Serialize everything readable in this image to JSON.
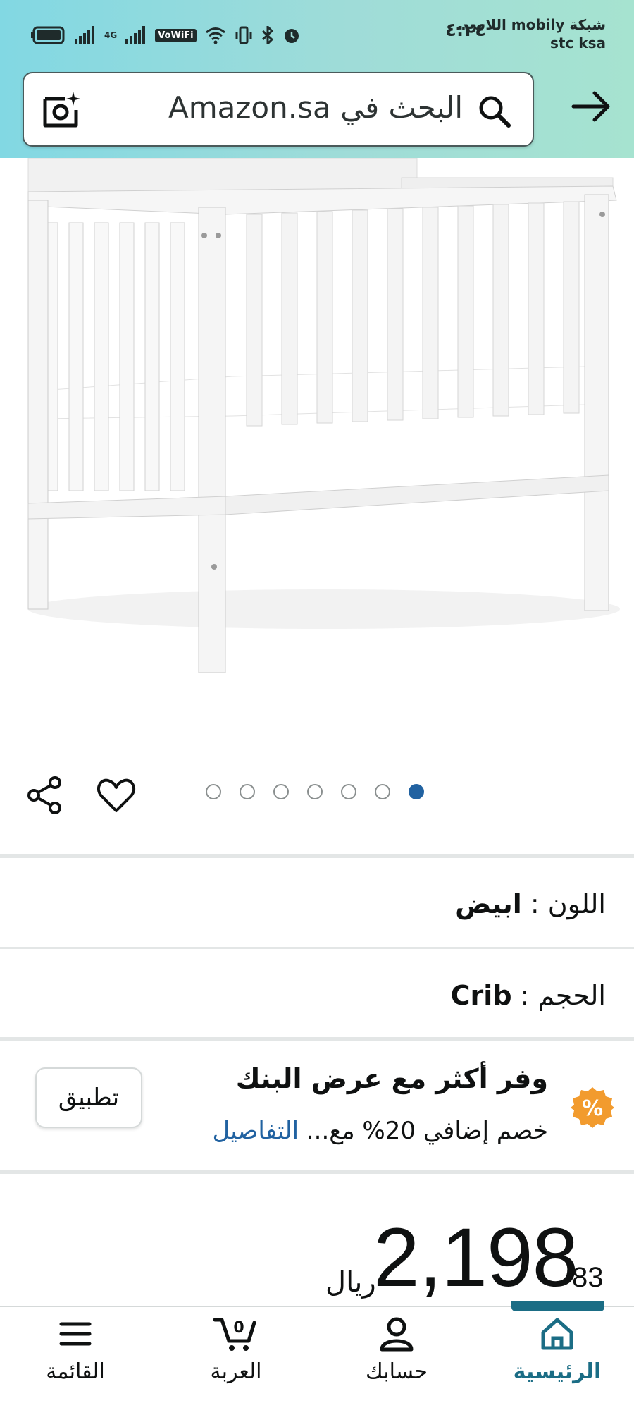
{
  "status_bar": {
    "carrier_line1": "شبكة mobily اللاس..",
    "carrier_line2": "stc ksa",
    "time": "٤:٢٤",
    "network_labels": [
      "4G",
      "VoWiFi"
    ]
  },
  "search": {
    "placeholder": "البحث في Amazon.sa"
  },
  "gallery": {
    "image_count": 7,
    "active_index": 6
  },
  "details": {
    "color_label": "اللون :",
    "color_value": "ابيض",
    "size_label": "الحجم :",
    "size_value": "Crib"
  },
  "bank_offer": {
    "badge": "%",
    "title": "وفر أكثر مع عرض البنك",
    "subtitle": "خصم إضافي 20% مع...",
    "details_link": "التفاصيل",
    "apply_label": "تطبيق"
  },
  "price": {
    "currency": "ريال",
    "whole": "2,198",
    "fraction": "83"
  },
  "bottom_nav": {
    "items": [
      {
        "label": "الرئيسية",
        "icon": "home-icon",
        "active": true
      },
      {
        "label": "حسابك",
        "icon": "person-icon",
        "active": false
      },
      {
        "label": "العربة",
        "icon": "cart-icon",
        "active": false,
        "badge": "0"
      },
      {
        "label": "القائمة",
        "icon": "menu-icon",
        "active": false
      }
    ]
  },
  "colors": {
    "accent": "#2162a1",
    "nav_active": "#1b6d85",
    "badge_orange": "#f29b2e"
  }
}
